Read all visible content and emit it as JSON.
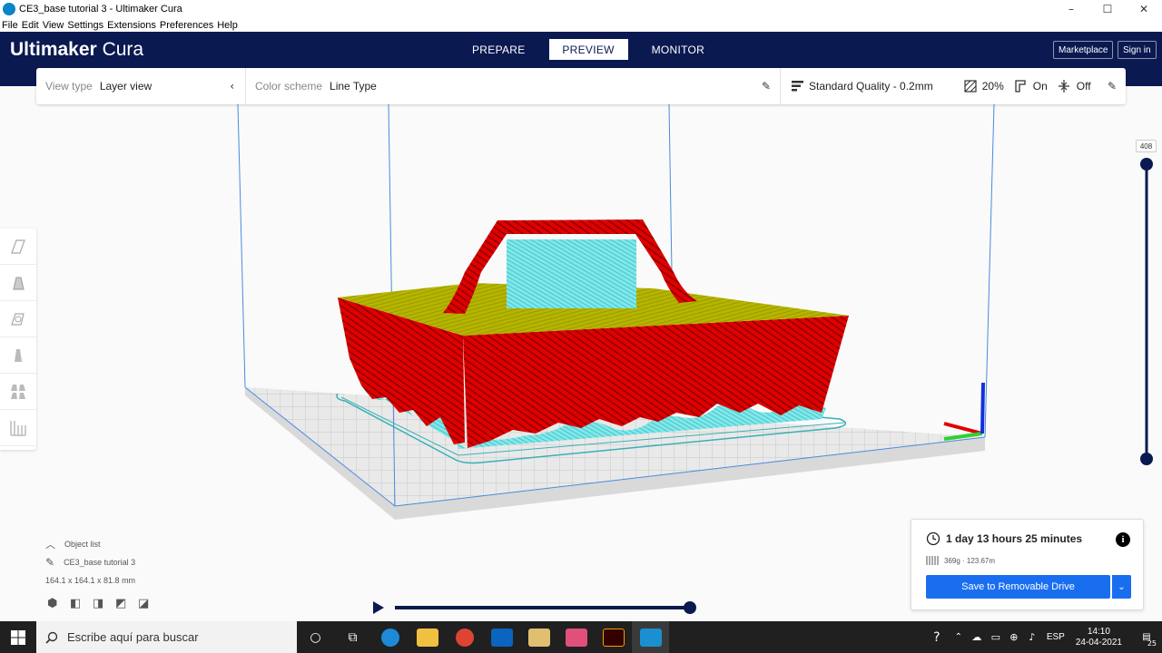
{
  "window": {
    "title": "CE3_base tutorial 3 - Ultimaker Cura",
    "minimize": "–",
    "maximize": "☐",
    "close": "✕"
  },
  "menu": [
    "File",
    "Edit",
    "View",
    "Settings",
    "Extensions",
    "Preferences",
    "Help"
  ],
  "header": {
    "logo_bold": "Ultimaker",
    "logo_light": "Cura",
    "tabs": [
      "PREPARE",
      "PREVIEW",
      "MONITOR"
    ],
    "active_tab": "PREVIEW",
    "marketplace": "Marketplace",
    "signin": "Sign in"
  },
  "stage_menu": {
    "view_type_label": "View type",
    "view_type_value": "Layer view",
    "color_scheme_label": "Color scheme",
    "color_scheme_value": "Line Type",
    "quality": "Standard Quality - 0.2mm",
    "infill": "20%",
    "support": "On",
    "adhesion": "Off"
  },
  "layer_slider": {
    "current_layer": "408",
    "fraction": 1.0
  },
  "object_list": {
    "toggle_label": "Object list",
    "object_name": "CE3_base tutorial 3",
    "dimensions": "164.1 x 164.1 x 81.8 mm"
  },
  "simulation": {
    "progress": 1.0
  },
  "print_info": {
    "time": "1 day 13 hours 25 minutes",
    "material": "369g · 123.67m",
    "info": "i",
    "save_label": "Save to Removable Drive"
  },
  "taskbar": {
    "search_placeholder": "Escribe aquí para buscar",
    "language": "ESP",
    "time": "14:10",
    "date": "24-04-2021",
    "notifications": "25"
  },
  "colors": {
    "header_bg": "#0b1951",
    "primary_button": "#196ef0",
    "wall_red": "#e00000",
    "skin_yellow": "#b4b400",
    "support_cyan": "#6ee0e0",
    "slider_navy": "#0b1951"
  },
  "icons": {
    "toolbar": [
      "move-icon",
      "scale-icon",
      "rotate-icon",
      "mirror-icon",
      "per-model-settings-icon",
      "support-blocker-icon"
    ],
    "camera_views": [
      "3d-view-icon",
      "front-view-icon",
      "top-view-icon",
      "left-view-icon",
      "right-view-icon"
    ]
  }
}
